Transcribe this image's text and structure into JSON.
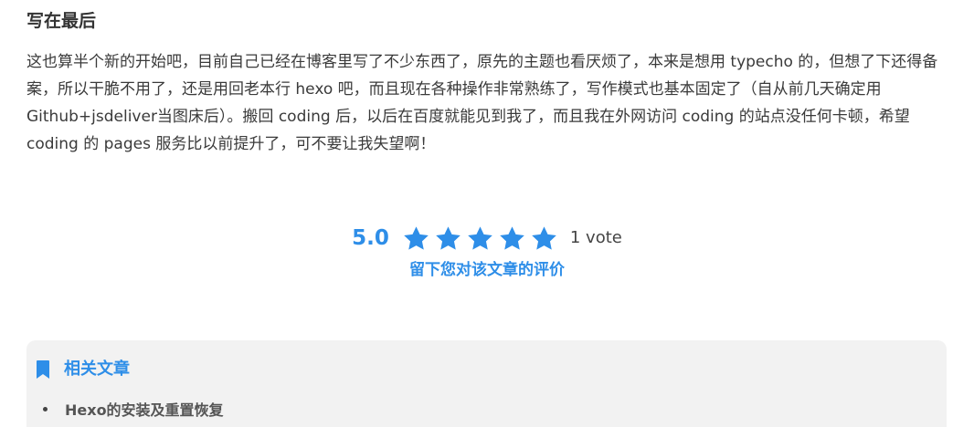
{
  "article": {
    "section_heading": "写在最后",
    "paragraph": "这也算半个新的开始吧，目前自己已经在博客里写了不少东西了，原先的主题也看厌烦了，本来是想用 typecho 的，但想了下还得备案，所以干脆不用了，还是用回老本行 hexo 吧，而且现在各种操作非常熟练了，写作模式也基本固定了（自从前几天确定用Github+jsdeliver当图床后）。搬回 coding 后，以后在百度就能见到我了，而且我在外网访问 coding 的站点没任何卡顿，希望 coding 的 pages 服务比以前提升了，可不要让我失望啊！"
  },
  "rating": {
    "score": "5.0",
    "stars_filled": 5,
    "stars_total": 5,
    "vote_count": "1 vote",
    "rate_link": "留下您对该文章的评价",
    "star_icon": "star-icon",
    "accent_color": "#2e8ee8"
  },
  "related": {
    "title": "相关文章",
    "icon": "bookmark-icon",
    "items": [
      {
        "label": "Hexo的安装及重置恢复"
      }
    ],
    "background_color": "#f2f2f2"
  }
}
